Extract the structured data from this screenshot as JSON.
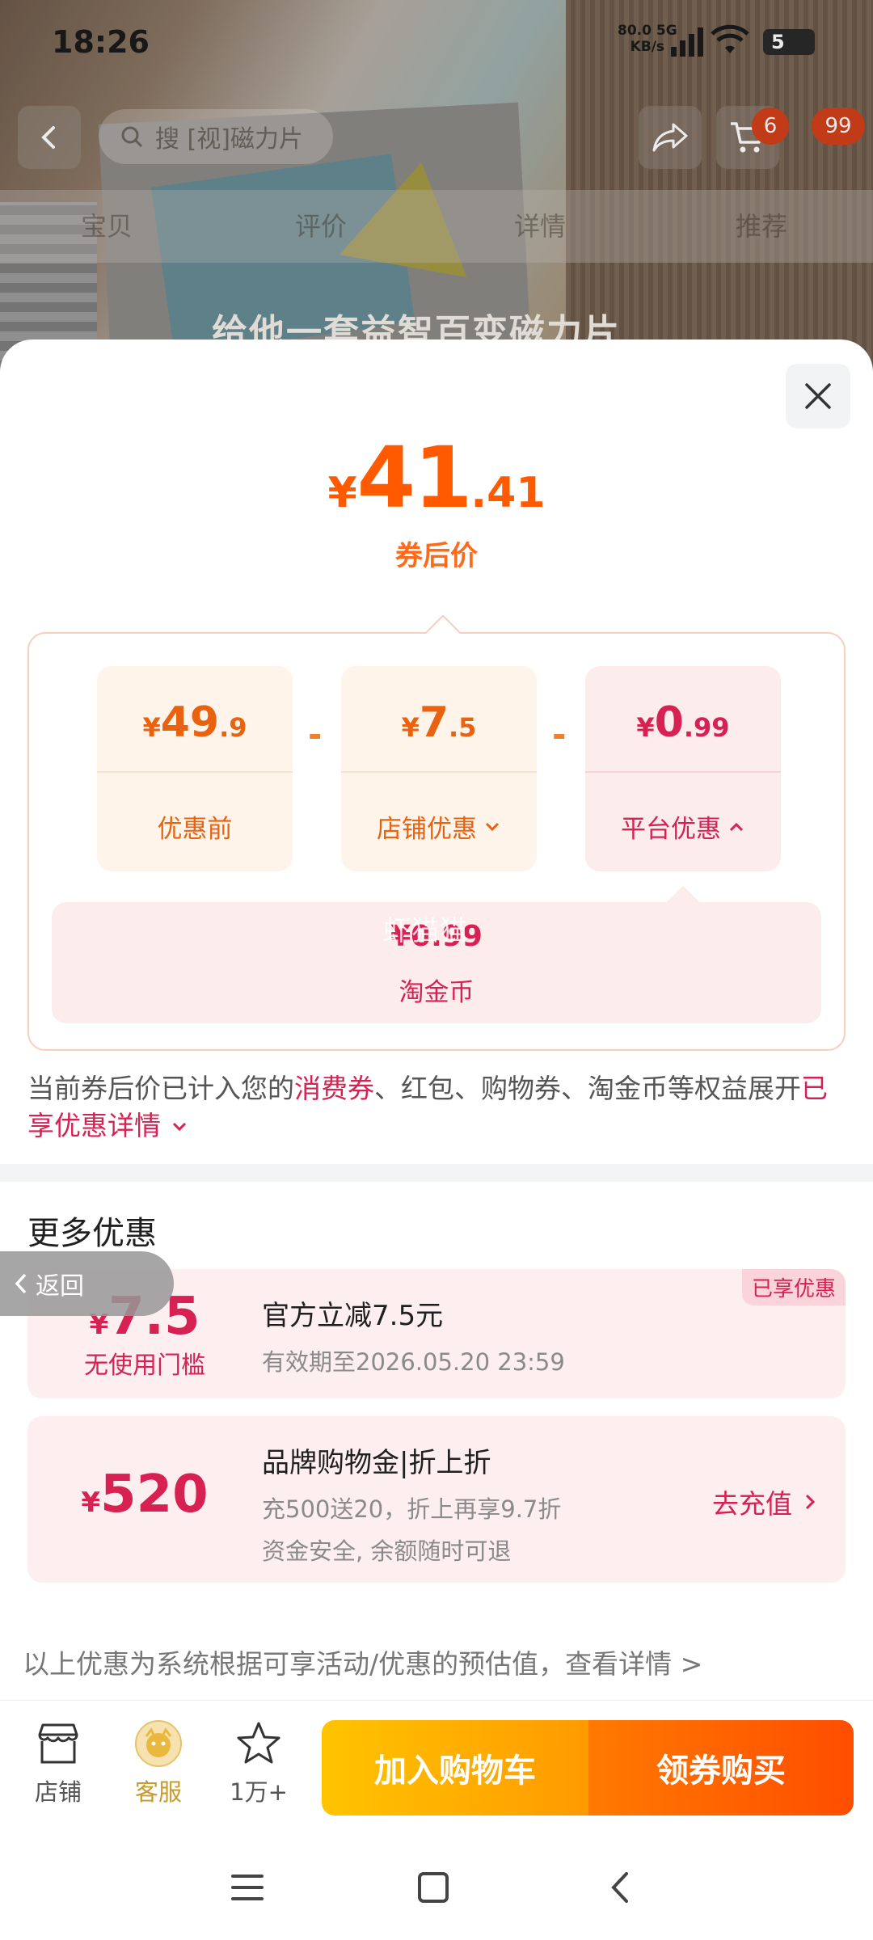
{
  "status_bar": {
    "time": "18:26",
    "net_speed_value": "80.0",
    "net_speed_unit": "KB/s",
    "network": "5G",
    "battery": "5"
  },
  "nav": {
    "search_placeholder": "搜 [视]磁力片",
    "cart_count": "6",
    "message_count": "99"
  },
  "tabs": [
    "宝贝",
    "评价",
    "详情",
    "推荐"
  ],
  "overlay_title": "给他一套益智百变磁力片",
  "sheet": {
    "price": {
      "currency": "¥",
      "integer": "41",
      "decimal": ".41",
      "label": "券后价"
    },
    "breakdown": [
      {
        "currency": "¥",
        "integer": "49",
        "decimal": ".9",
        "label": "优惠前"
      },
      {
        "currency": "¥",
        "integer": "7",
        "decimal": ".5",
        "label": "店铺优惠"
      },
      {
        "currency": "¥",
        "integer": "0",
        "decimal": ".99",
        "label": "平台优惠"
      }
    ],
    "operators": [
      "-",
      "-"
    ],
    "coin": {
      "value": "¥0.99",
      "label": "淘金币",
      "watermark": "虾猫猫"
    },
    "note": {
      "part1": "当前券后价已计入您的",
      "highlight1": "消费券",
      "part2": "、红包、购物券、淘金币等权益展开",
      "link": "已享优惠详情"
    },
    "more_title": "更多优惠",
    "back_label": "返回",
    "offers": [
      {
        "currency": "¥",
        "amount": "7.5",
        "sub": "无使用门槛",
        "title": "官方立减7.5元",
        "desc": "有效期至2026.05.20 23:59",
        "tag": "已享优惠"
      },
      {
        "currency": "¥",
        "amount": "520",
        "title": "品牌购物金|折上折",
        "desc1": "充500送20，折上再享9.7折",
        "desc2": "资金安全, 余额随时可退",
        "action": "去充值"
      }
    ],
    "disclaimer": "以上优惠为系统根据可享活动/优惠的预估值，查看详情 >"
  },
  "action_bar": {
    "shop": "店铺",
    "service": "客服",
    "favorites": "1万+",
    "add_to_cart": "加入购物车",
    "buy": "领券购买"
  },
  "colors": {
    "price_orange": "#ff5a00",
    "platform_red": "#d72152",
    "cta_yellow": "#ffc400",
    "cta_orange": "#ff4d00"
  }
}
